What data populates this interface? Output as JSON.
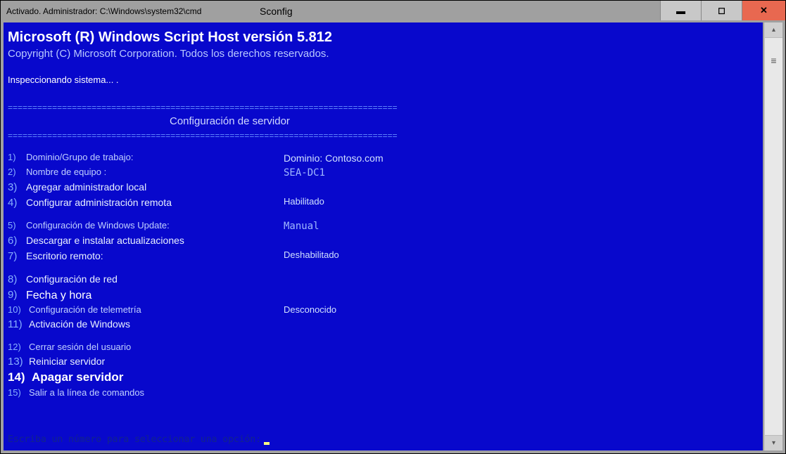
{
  "titlebar": {
    "prefix": "Activado. Administrador: C:\\Windows\\system32\\cmd",
    "suffix": "Sconfig"
  },
  "header": {
    "title": "Microsoft (R) Windows Script Host versión 5.812",
    "copyright": "Copyright (C) Microsoft Corporation. Todos los derechos reservados.",
    "inspecting": "Inspeccionando sistema...    ."
  },
  "divider": "===============================================================================",
  "section_title": "Configuración de servidor",
  "menu": {
    "r1": {
      "num": "1)",
      "label": "Dominio/Grupo de trabajo:",
      "value": "Dominio: Contoso.com"
    },
    "r2": {
      "num": "2)",
      "label": "Nombre de equipo    :",
      "value": "SEA-DC1"
    },
    "r3": {
      "num": "3)",
      "label": "Agregar administrador local",
      "value": ""
    },
    "r4": {
      "num": "4)",
      "label": "Configurar administración remota",
      "value": "Habilitado"
    },
    "r5": {
      "num": "5)",
      "label": "Configuración de Windows Update:",
      "value": "Manual"
    },
    "r6": {
      "num": "6)",
      "label": "Descargar e instalar actualizaciones",
      "value": ""
    },
    "r7": {
      "num": "7)",
      "label": "Escritorio remoto:",
      "value": "Deshabilitado"
    },
    "r8": {
      "num": "8)",
      "label": "Configuración de red",
      "value": ""
    },
    "r9": {
      "num": "9)",
      "label": "Fecha y hora",
      "value": ""
    },
    "r10": {
      "num": "10)",
      "label": "Configuración de telemetría",
      "value": "Desconocido"
    },
    "r11": {
      "num": "11)",
      "label": "Activación de Windows",
      "value": ""
    },
    "r12": {
      "num": "12)",
      "label": "Cerrar sesión del usuario",
      "value": ""
    },
    "r13": {
      "num": "13)",
      "label": "Reiniciar servidor",
      "value": ""
    },
    "r14": {
      "num": "14)",
      "label": "Apagar servidor",
      "value": ""
    },
    "r15": {
      "num": "15)",
      "label": "Salir a la línea de comandos",
      "value": ""
    }
  },
  "prompt": "Escriba un número para seleccionar una opción:"
}
